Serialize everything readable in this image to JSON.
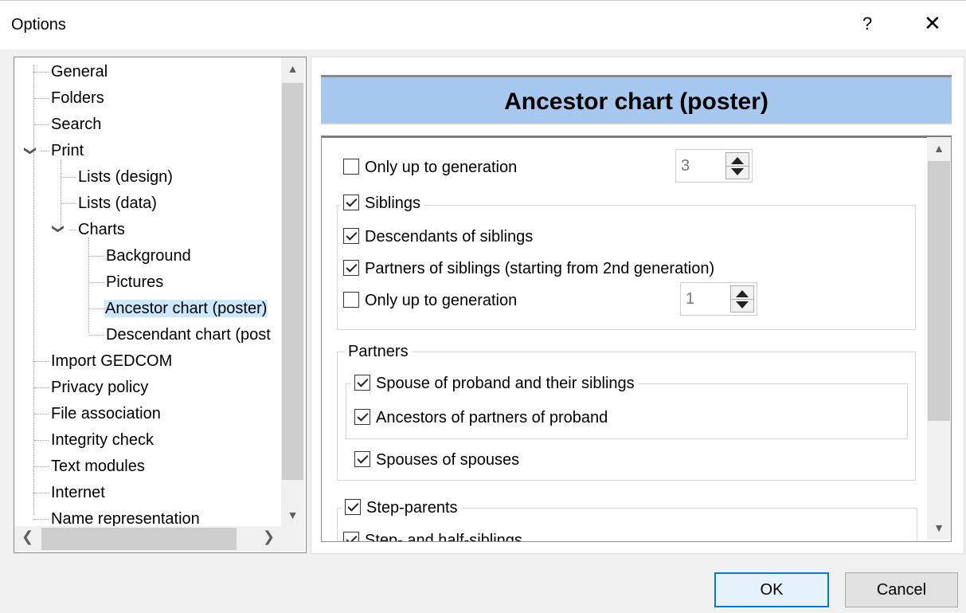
{
  "window": {
    "title": "Options",
    "help": "?",
    "close": "✕"
  },
  "tree": {
    "items": [
      {
        "label": "General"
      },
      {
        "label": "Folders"
      },
      {
        "label": "Search"
      },
      {
        "label": "Print"
      },
      {
        "label": "Lists (design)"
      },
      {
        "label": "Lists (data)"
      },
      {
        "label": "Charts"
      },
      {
        "label": "Background"
      },
      {
        "label": "Pictures"
      },
      {
        "label": "Ancestor chart (poster)"
      },
      {
        "label": "Descendant chart (post"
      },
      {
        "label": "Import GEDCOM"
      },
      {
        "label": "Privacy policy"
      },
      {
        "label": "File association"
      },
      {
        "label": "Integrity check"
      },
      {
        "label": "Text modules"
      },
      {
        "label": "Internet"
      },
      {
        "label": "Name representation"
      }
    ],
    "selected": "Ancestor chart (poster)"
  },
  "panel": {
    "title": "Ancestor chart (poster)",
    "only_up_to_generation_1": {
      "label": "Only up to generation",
      "checked": false,
      "value": "3"
    },
    "siblings": {
      "label": "Siblings",
      "checked": true
    },
    "descendants_of_siblings": {
      "label": "Descendants of siblings",
      "checked": true
    },
    "partners_of_siblings": {
      "label": "Partners of siblings (starting from 2nd generation)",
      "checked": true
    },
    "only_up_to_generation_2": {
      "label": "Only up to generation",
      "checked": false,
      "value": "1"
    },
    "partners_group": "Partners",
    "spouse_of_proband": {
      "label": "Spouse of proband and their siblings",
      "checked": true
    },
    "ancestors_of_partners": {
      "label": "Ancestors of partners of proband",
      "checked": true
    },
    "spouses_of_spouses": {
      "label": "Spouses of spouses",
      "checked": true
    },
    "step_parents": {
      "label": "Step-parents",
      "checked": true
    },
    "step_half_siblings": {
      "label": "Step- and half-siblings",
      "checked": true
    }
  },
  "buttons": {
    "ok": "OK",
    "cancel": "Cancel"
  },
  "colors": {
    "header_bg": "#a6c8ee",
    "selection": "#cce8ff",
    "default_button_border": "#0078d7"
  }
}
